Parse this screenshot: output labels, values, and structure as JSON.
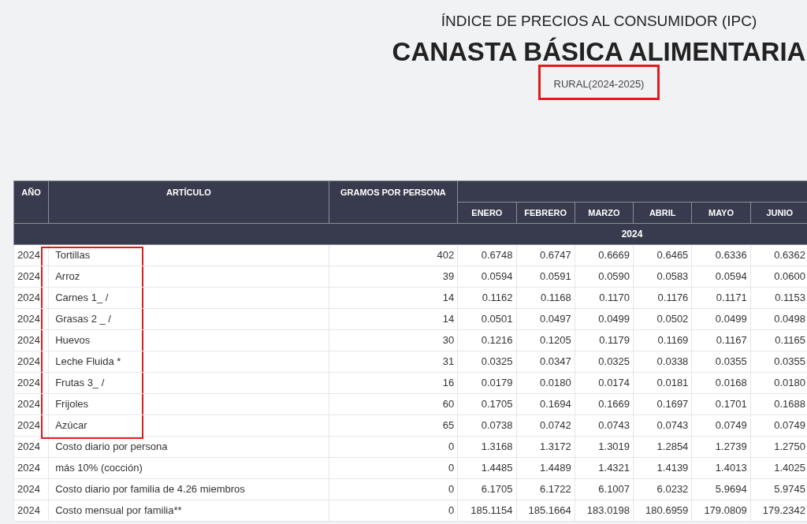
{
  "header": {
    "kicker": "ÍNDICE DE PRECIOS AL CONSUMIDOR (IPC)",
    "title": "CANASTA BÁSICA ALIMENTARIA",
    "subtitle": "RURAL(2024-2025)",
    "subtitle_highlighted": true
  },
  "table": {
    "columns": [
      "AÑO",
      "ARTÍCULO",
      "GRAMOS POR PERSONA"
    ],
    "months": [
      "ENERO",
      "FEBRERO",
      "MARZO",
      "ABRIL",
      "MAYO",
      "JUNIO"
    ],
    "group_label": "2024",
    "rows": [
      {
        "year": "2024",
        "article": "Tortillas",
        "grams": "402",
        "values": [
          "0.6748",
          "0.6747",
          "0.6669",
          "0.6465",
          "0.6336",
          "0.6362"
        ],
        "highlighted": true
      },
      {
        "year": "2024",
        "article": "Arroz",
        "grams": "39",
        "values": [
          "0.0594",
          "0.0591",
          "0.0590",
          "0.0583",
          "0.0594",
          "0.0600"
        ],
        "highlighted": true
      },
      {
        "year": "2024",
        "article": "Carnes 1_ /",
        "grams": "14",
        "values": [
          "0.1162",
          "0.1168",
          "0.1170",
          "0.1176",
          "0.1171",
          "0.1153"
        ],
        "highlighted": true
      },
      {
        "year": "2024",
        "article": "Grasas 2 _ /",
        "grams": "14",
        "values": [
          "0.0501",
          "0.0497",
          "0.0499",
          "0.0502",
          "0.0499",
          "0.0498"
        ],
        "highlighted": true
      },
      {
        "year": "2024",
        "article": "Huevos",
        "grams": "30",
        "values": [
          "0.1216",
          "0.1205",
          "0.1179",
          "0.1169",
          "0.1167",
          "0.1165"
        ],
        "highlighted": true
      },
      {
        "year": "2024",
        "article": "Leche Fluida *",
        "grams": "31",
        "values": [
          "0.0325",
          "0.0347",
          "0.0325",
          "0.0338",
          "0.0355",
          "0.0355"
        ],
        "highlighted": true
      },
      {
        "year": "2024",
        "article": "Frutas 3_ /",
        "grams": "16",
        "values": [
          "0.0179",
          "0.0180",
          "0.0174",
          "0.0181",
          "0.0168",
          "0.0180"
        ],
        "highlighted": true
      },
      {
        "year": "2024",
        "article": "Frijoles",
        "grams": "60",
        "values": [
          "0.1705",
          "0.1694",
          "0.1669",
          "0.1697",
          "0.1701",
          "0.1688"
        ],
        "highlighted": true
      },
      {
        "year": "2024",
        "article": "Azúcar",
        "grams": "65",
        "values": [
          "0.0738",
          "0.0742",
          "0.0743",
          "0.0743",
          "0.0749",
          "0.0749"
        ],
        "highlighted": true
      },
      {
        "year": "2024",
        "article": "Costo diario por persona",
        "grams": "0",
        "values": [
          "1.3168",
          "1.3172",
          "1.3019",
          "1.2854",
          "1.2739",
          "1.2750"
        ],
        "highlighted": false
      },
      {
        "year": "2024",
        "article": "más 10% (cocción)",
        "grams": "0",
        "values": [
          "1.4485",
          "1.4489",
          "1.4321",
          "1.4139",
          "1.4013",
          "1.4025"
        ],
        "highlighted": false
      },
      {
        "year": "2024",
        "article": "Costo diario por familia de 4.26 miembros",
        "grams": "0",
        "values": [
          "6.1705",
          "6.1722",
          "6.1007",
          "6.0232",
          "5.9694",
          "5.9745"
        ],
        "highlighted": false
      },
      {
        "year": "2024",
        "article": "Costo mensual por familia**",
        "grams": "0",
        "values": [
          "185.1154",
          "185.1664",
          "183.0198",
          "180.6959",
          "179.0809",
          "179.2342"
        ],
        "highlighted": false
      }
    ]
  }
}
